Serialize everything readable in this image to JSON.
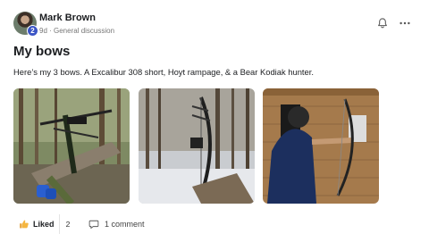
{
  "post": {
    "author": "Mark Brown",
    "author_level": "2",
    "meta": "9d · General discussion",
    "title": "My bows",
    "body": "Here’s my 3 bows. A Excalibur 308 short, Hoyt rampage, & a Bear Kodiak hunter.",
    "photos": [
      {
        "icon": "photo-crossbow-in-woods"
      },
      {
        "icon": "photo-compound-bow-in-snow"
      },
      {
        "icon": "photo-man-with-longbow"
      }
    ]
  },
  "actions": {
    "like_label": "Liked",
    "like_count": "2",
    "comment_label": "1 comment"
  },
  "colors": {
    "badge": "#3b55c6",
    "text": "#1c1e21",
    "muted": "#777777"
  }
}
